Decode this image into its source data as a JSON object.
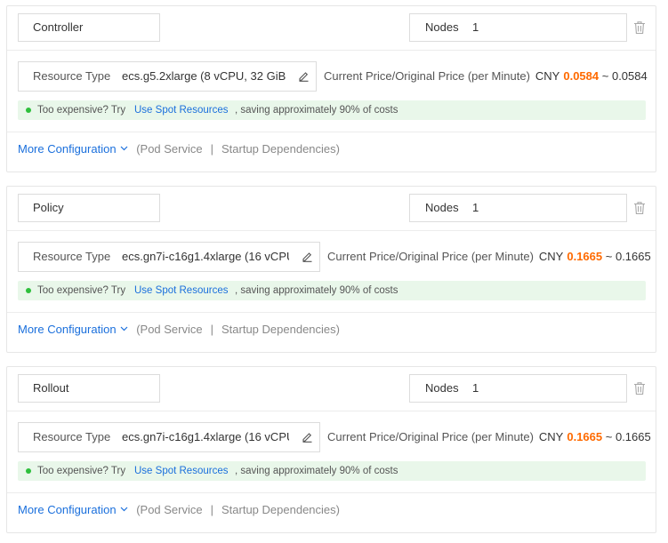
{
  "labels": {
    "nodes": "Nodes",
    "resource_type": "Resource Type",
    "price_label": "Current Price/Original Price (per Minute)",
    "currency": "CNY",
    "price_sep": "~",
    "tip_prefix": "Too expensive? Try",
    "tip_link": "Use Spot Resources",
    "tip_suffix": ", saving approximately 90% of costs",
    "more_config": "More Configuration",
    "pod_service": "(Pod Service",
    "separator": "|",
    "startup_deps": "Startup Dependencies)"
  },
  "colors": {
    "accent_link": "#1a6fdc",
    "price_highlight": "#ff6a00",
    "tip_background": "#e9f7ea",
    "tip_dot": "#2ebf3c"
  },
  "icons": {
    "delete": "trash-icon",
    "edit": "edit-pencil-icon",
    "dropdown": "chevron-down-icon",
    "status": "green-dot-icon"
  },
  "cards": [
    {
      "name": "Controller",
      "nodes": "1",
      "resource_type": "ecs.g5.2xlarge  (8 vCPU, 32 GiB",
      "current_price": "0.0584",
      "original_price": "0.0584"
    },
    {
      "name": "Policy",
      "nodes": "1",
      "resource_type": "ecs.gn7i-c16g1.4xlarge  (16 vCPU",
      "current_price": "0.1665",
      "original_price": "0.1665"
    },
    {
      "name": "Rollout",
      "nodes": "1",
      "resource_type": "ecs.gn7i-c16g1.4xlarge  (16 vCPU",
      "current_price": "0.1665",
      "original_price": "0.1665"
    }
  ]
}
